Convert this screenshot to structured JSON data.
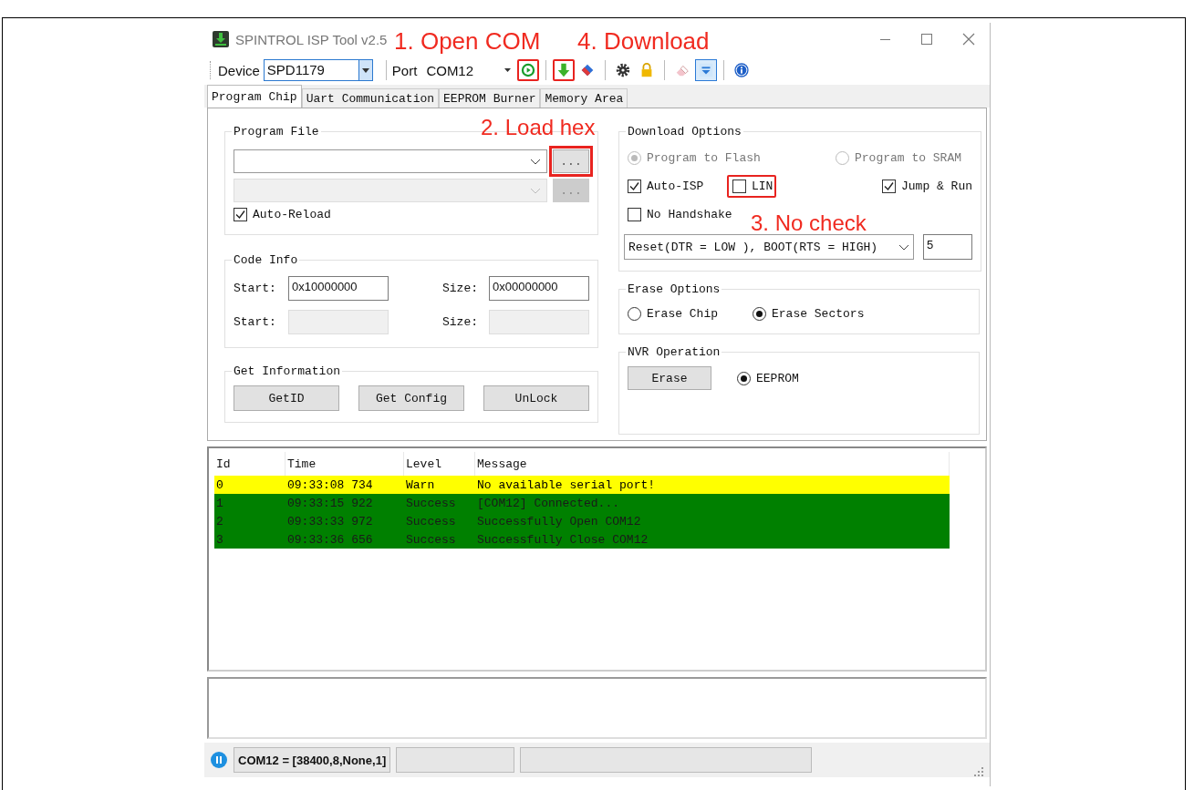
{
  "window": {
    "title": "SPINTROL ISP Tool v2.5"
  },
  "toolbar": {
    "device_label": "Device",
    "device": "SPD1179",
    "port_label": "Port",
    "port": "COM12",
    "annotations": [
      "1. Open COM",
      "4. Download"
    ],
    "groups": [
      [
        {
          "kind": "open",
          "highlighted": true,
          "pressed": false
        }
      ],
      [
        {
          "kind": "download",
          "highlighted": true,
          "pressed": false
        },
        {
          "kind": "erase",
          "highlighted": false,
          "pressed": false
        }
      ],
      [
        {
          "kind": "settings",
          "highlighted": false,
          "pressed": false
        },
        {
          "kind": "lock",
          "highlighted": false,
          "pressed": false
        }
      ],
      [
        {
          "kind": "clear",
          "highlighted": false,
          "pressed": false
        },
        {
          "kind": "log",
          "highlighted": false,
          "pressed": true
        }
      ],
      [
        {
          "kind": "info",
          "highlighted": false,
          "pressed": false
        }
      ]
    ]
  },
  "tabs": [
    {
      "label": "Program Chip",
      "selected": true
    },
    {
      "label": "Uart Communication",
      "selected": false
    },
    {
      "label": "EEPROM Burner",
      "selected": false
    },
    {
      "label": "Memory Area",
      "selected": false
    }
  ],
  "program_file": {
    "title": "Program File",
    "annotation": "2. Load hex",
    "rows": [
      {
        "browse": "...",
        "disabled": false,
        "highlighted": true
      },
      {
        "browse": "...",
        "disabled": true,
        "highlighted": false
      }
    ],
    "auto_reload": {
      "label": "Auto-Reload",
      "checked": true
    }
  },
  "code_info": {
    "title": "Code Info",
    "rows": [
      {
        "start_label": "Start:",
        "start": "0x10000000",
        "size_label": "Size:",
        "size": "0x00000000",
        "disabled": false
      },
      {
        "start_label": "Start:",
        "size_label": "Size:",
        "disabled": true
      }
    ]
  },
  "get_information": {
    "title": "Get Information",
    "buttons": [
      "GetID",
      "Get Config",
      "UnLock"
    ]
  },
  "download_options": {
    "title": "Download Options",
    "annotation": "3. No check",
    "radios": [
      {
        "label": "Program to Flash",
        "selected": true,
        "disabled": true
      },
      {
        "label": "Program to SRAM",
        "selected": false,
        "disabled": true
      }
    ],
    "checks": [
      {
        "label": "Auto-ISP",
        "checked": true,
        "annotated": false
      },
      {
        "label": "LIN",
        "checked": false,
        "annotated": true
      },
      {
        "label": "Jump & Run",
        "checked": true,
        "annotated": false
      },
      {
        "label": "No Handshake",
        "checked": false,
        "annotated": false
      }
    ],
    "reset_mode": "Reset(DTR = LOW ), BOOT(RTS = HIGH)",
    "retries": "5"
  },
  "erase_options": {
    "title": "Erase Options",
    "radios": [
      {
        "label": "Erase Chip",
        "selected": false
      },
      {
        "label": "Erase Sectors",
        "selected": true
      }
    ]
  },
  "nvr_operation": {
    "title": "NVR Operation",
    "button": "Erase",
    "radios": [
      {
        "label": "EEPROM",
        "selected": true
      }
    ]
  },
  "log": {
    "columns": [
      "Id",
      "Time",
      "Level",
      "Message"
    ],
    "rows": [
      {
        "kind": "warn",
        "cells": [
          "0",
          "09:33:08 734",
          "Warn",
          "No available serial port!"
        ]
      },
      {
        "kind": "success",
        "cells": [
          "1",
          "09:33:15 922",
          "Success",
          "[COM12] Connected..."
        ]
      },
      {
        "kind": "success",
        "cells": [
          "2",
          "09:33:33 972",
          "Success",
          "Successfully Open COM12"
        ]
      },
      {
        "kind": "success",
        "cells": [
          "3",
          "09:33:36 656",
          "Success",
          "Successfully Close COM12"
        ]
      }
    ]
  },
  "status_bar": {
    "connection": "COM12 = [38400,8,None,1]"
  }
}
